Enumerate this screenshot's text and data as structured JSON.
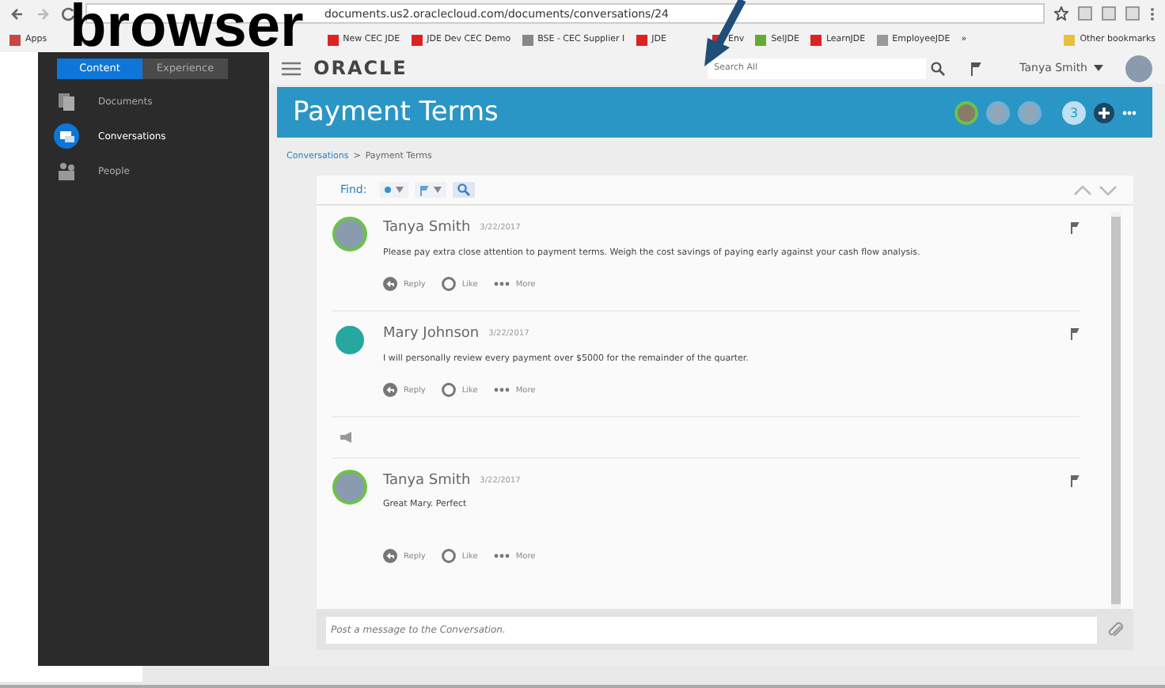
{
  "annotation": {
    "label": "browser"
  },
  "browser": {
    "url": "documents.us2.oraclecloud.com/documents/conversations/24",
    "bookmarks": [
      {
        "label": "Apps"
      },
      {
        "label": "New CEC JDE"
      },
      {
        "label": "JDE Dev CEC Demo"
      },
      {
        "label": "BSE - CEC Supplier I"
      },
      {
        "label": "JDE"
      },
      {
        "label": "Env"
      },
      {
        "label": "SelJDE"
      },
      {
        "label": "LearnJDE"
      },
      {
        "label": "EmployeeJDE"
      },
      {
        "label": "»"
      },
      {
        "label": "Other bookmarks"
      }
    ]
  },
  "sidebar": {
    "tabs": [
      {
        "label": "Content",
        "selected": true
      },
      {
        "label": "Experience",
        "selected": false
      }
    ],
    "items": [
      {
        "label": "Documents",
        "selected": false
      },
      {
        "label": "Conversations",
        "selected": true
      },
      {
        "label": "People",
        "selected": false
      }
    ]
  },
  "header": {
    "logo": "ORACLE",
    "search": {
      "placeholder": "Search All"
    },
    "user": "Tanya Smith"
  },
  "conversation": {
    "title": "Payment Terms",
    "members": [
      {
        "online": true
      },
      {
        "online": false
      },
      {
        "online": false
      }
    ],
    "member_count": "3",
    "breadcrumb": [
      "Conversations",
      ">",
      "Payment Terms"
    ],
    "find_label": "Find:",
    "messages": [
      {
        "author": "Tanya Smith",
        "date": "3/22/2017",
        "online": true,
        "text": "Please pay extra close attention to payment terms.  Weigh the cost savings of paying early against your cash flow analysis.",
        "actions": [
          "Reply",
          "Like",
          "More"
        ]
      },
      {
        "author": "Mary Johnson",
        "date": "3/22/2017",
        "online": false,
        "text": "I will personally review every payment over $5000 for the remainder of the quarter.",
        "actions": [
          "Reply",
          "Like",
          "More"
        ]
      },
      {
        "author": "Tanya Smith",
        "date": "3/22/2017",
        "online": true,
        "text": "Great Mary.  Perfect",
        "actions": [
          "Reply",
          "Like",
          "More"
        ]
      }
    ],
    "composer": {
      "placeholder": "Post a message to the Conversation."
    }
  }
}
